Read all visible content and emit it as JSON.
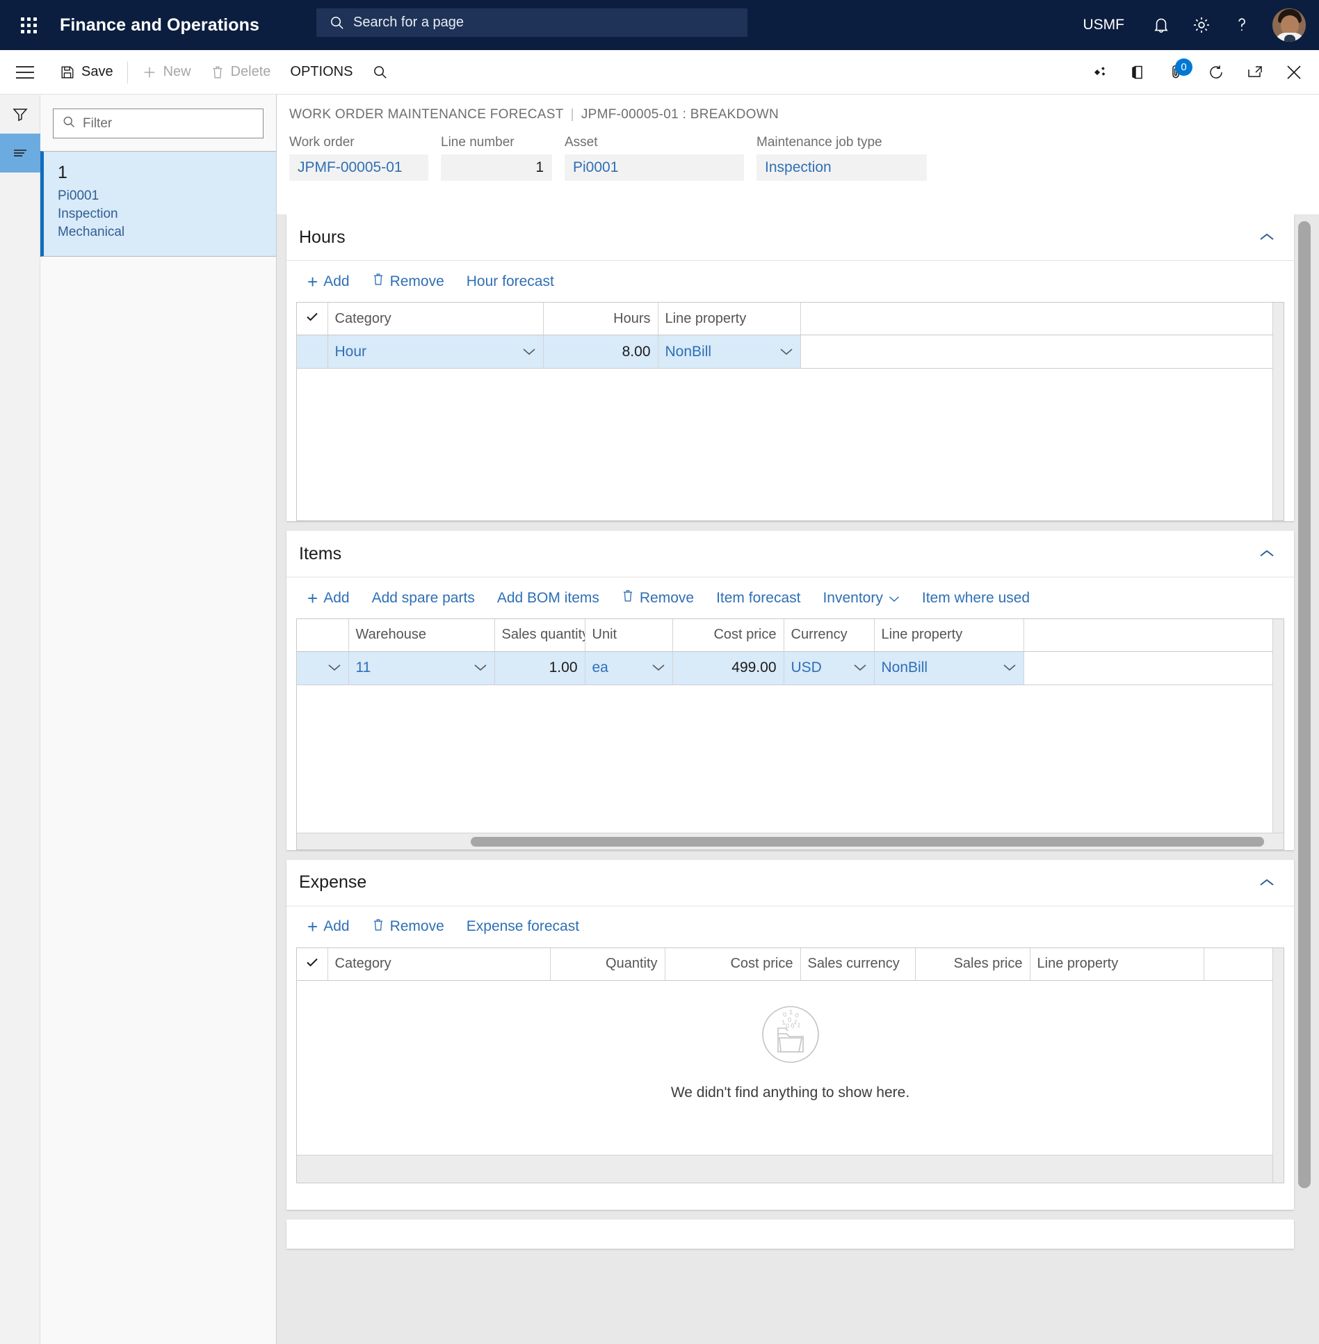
{
  "top_nav": {
    "waffle_icon": "app-launcher-icon",
    "app_title": "Finance and Operations",
    "search_placeholder": "Search for a page",
    "search_value": "",
    "company": "USMF",
    "icons": [
      "notification-bell-icon",
      "settings-gear-icon",
      "help-question-icon"
    ],
    "avatar": "user-avatar"
  },
  "action_pane": {
    "save_label": "Save",
    "new_label": "New",
    "delete_label": "Delete",
    "options_label": "OPTIONS",
    "search_icon": "search-icon",
    "right_icons": [
      "office-apps-icon",
      "open-in-office-icon",
      "attachments-icon",
      "refresh-icon",
      "popout-icon",
      "close-icon"
    ],
    "attachment_badge": "0"
  },
  "rail": {
    "filter_icon": "filter-funnel-icon",
    "list_icon": "list-lines-icon"
  },
  "list_pane": {
    "filter_placeholder": "Filter",
    "filter_value": "",
    "items": [
      {
        "title": "1",
        "line1": "Pi0001",
        "line2": "Inspection",
        "line3": "Mechanical"
      }
    ]
  },
  "breadcrumb": {
    "page": "WORK ORDER MAINTENANCE FORECAST",
    "separator": "|",
    "record": "JPMF-00005-01 : BREAKDOWN"
  },
  "header_fields": [
    {
      "label": "Work order",
      "value": "JPMF-00005-01",
      "align": "left"
    },
    {
      "label": "Line number",
      "value": "1",
      "align": "right"
    },
    {
      "label": "Asset",
      "value": "Pi0001",
      "align": "left"
    },
    {
      "label": "Maintenance job type",
      "value": "Inspection",
      "align": "left"
    }
  ],
  "sections": {
    "hours": {
      "title": "Hours",
      "collapse_icon": "chevron-up-icon",
      "toolbar": [
        {
          "label": "Add",
          "icon": "plus-icon"
        },
        {
          "label": "Remove",
          "icon": "trash-icon"
        },
        {
          "label": "Hour forecast",
          "icon": ""
        }
      ],
      "columns": [
        "Category",
        "Hours",
        "Line property"
      ],
      "rows": [
        {
          "category": "Hour",
          "hours": "8.00",
          "line_property": "NonBill"
        }
      ]
    },
    "items": {
      "title": "Items",
      "collapse_icon": "chevron-up-icon",
      "toolbar": [
        {
          "label": "Add",
          "icon": "plus-icon"
        },
        {
          "label": "Add spare parts",
          "icon": ""
        },
        {
          "label": "Add BOM items",
          "icon": ""
        },
        {
          "label": "Remove",
          "icon": "trash-icon"
        },
        {
          "label": "Item forecast",
          "icon": ""
        },
        {
          "label": "Inventory",
          "icon": "chevron-down-icon"
        },
        {
          "label": "Item where used",
          "icon": ""
        }
      ],
      "columns": [
        "Warehouse",
        "Sales quantity",
        "Unit",
        "Cost price",
        "Currency",
        "Line property"
      ],
      "rows": [
        {
          "warehouse": "11",
          "sales_quantity": "1.00",
          "unit": "ea",
          "cost_price": "499.00",
          "currency": "USD",
          "line_property": "NonBill"
        }
      ]
    },
    "expense": {
      "title": "Expense",
      "collapse_icon": "chevron-up-icon",
      "toolbar": [
        {
          "label": "Add",
          "icon": "plus-icon"
        },
        {
          "label": "Remove",
          "icon": "trash-icon"
        },
        {
          "label": "Expense forecast",
          "icon": ""
        }
      ],
      "columns": [
        "Category",
        "Quantity",
        "Cost price",
        "Sales currency",
        "Sales price",
        "Line property"
      ],
      "rows": [],
      "empty_message": "We didn't find anything to show here.",
      "empty_icon": "empty-folder-icon"
    }
  }
}
